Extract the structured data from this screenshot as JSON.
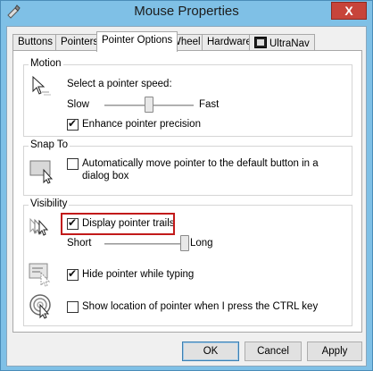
{
  "window": {
    "title": "Mouse Properties",
    "close_glyph": "X"
  },
  "tabs": [
    {
      "label": "Buttons"
    },
    {
      "label": "Pointers"
    },
    {
      "label": "Pointer Options"
    },
    {
      "label": "Wheel"
    },
    {
      "label": "Hardware"
    },
    {
      "label": "UltraNav"
    }
  ],
  "motion": {
    "label": "Motion",
    "speed_prompt": "Select a pointer speed:",
    "slow": "Slow",
    "fast": "Fast",
    "speed_level": 0.5,
    "enhance_label": "Enhance pointer precision",
    "enhance_checked": true
  },
  "snap_to": {
    "label": "Snap To",
    "option_line1": "Automatically move pointer to the default button in a",
    "option_line2": "dialog box",
    "checked": false
  },
  "visibility": {
    "label": "Visibility",
    "trails_label": "Display pointer trails",
    "trails_checked": true,
    "short": "Short",
    "long": "Long",
    "trail_level": 1.0,
    "hide_label": "Hide pointer while typing",
    "hide_checked": true,
    "show_location_label": "Show location of pointer when I press the CTRL key",
    "show_location_checked": false
  },
  "buttons": {
    "ok": "OK",
    "cancel": "Cancel",
    "apply": "Apply"
  }
}
